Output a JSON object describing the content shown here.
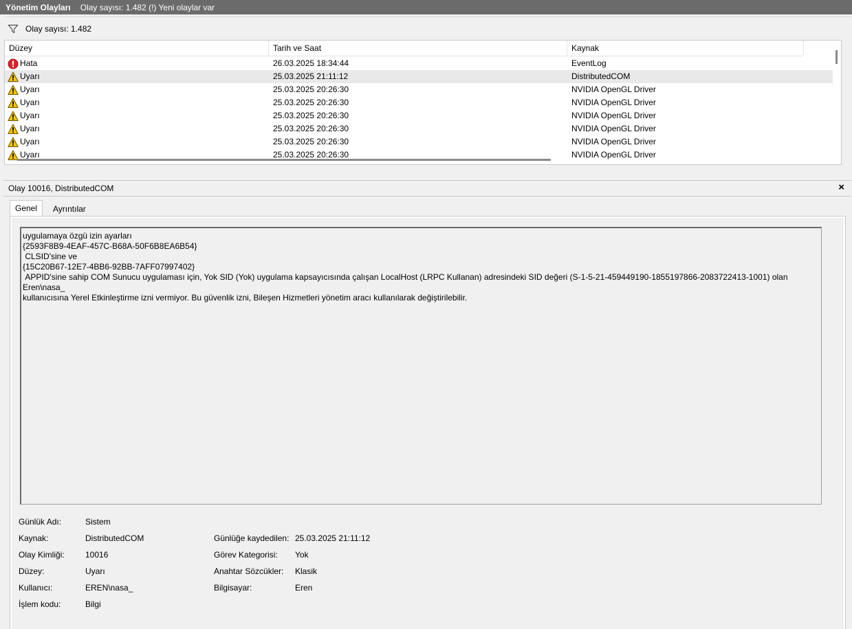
{
  "titlebar": {
    "title": "Yönetim Olayları",
    "subtitle": "Olay sayısı: 1.482 (!) Yeni olaylar var"
  },
  "filter": {
    "count_text": "Olay sayısı: 1.482",
    "icon": "filter-funnel-icon"
  },
  "columns": {
    "level": "Düzey",
    "date": "Tarih ve Saat",
    "source": "Kaynak"
  },
  "rows": [
    {
      "level": "Hata",
      "date": "26.03.2025 18:34:44",
      "source": "EventLog",
      "icon": "error-icon"
    },
    {
      "level": "Uyarı",
      "date": "25.03.2025 21:11:12",
      "source": "DistributedCOM",
      "icon": "warning-icon"
    },
    {
      "level": "Uyarı",
      "date": "25.03.2025 20:26:30",
      "source": "NVIDIA OpenGL Driver",
      "icon": "warning-icon"
    },
    {
      "level": "Uyarı",
      "date": "25.03.2025 20:26:30",
      "source": "NVIDIA OpenGL Driver",
      "icon": "warning-icon"
    },
    {
      "level": "Uyarı",
      "date": "25.03.2025 20:26:30",
      "source": "NVIDIA OpenGL Driver",
      "icon": "warning-icon"
    },
    {
      "level": "Uyarı",
      "date": "25.03.2025 20:26:30",
      "source": "NVIDIA OpenGL Driver",
      "icon": "warning-icon"
    },
    {
      "level": "Uyarı",
      "date": "25.03.2025 20:26:30",
      "source": "NVIDIA OpenGL Driver",
      "icon": "warning-icon"
    },
    {
      "level": "Uyarı",
      "date": "25.03.2025 20:26:30",
      "source": "NVIDIA OpenGL Driver",
      "icon": "warning-icon"
    }
  ],
  "colors": {
    "titlebar_bg": "#6b6b6b",
    "error": "#d9262e",
    "warning": "#f5c400",
    "selected_row": "#e9e9e9"
  },
  "detail": {
    "title": "Olay 10016, DistributedCOM",
    "close": "×",
    "tabs": {
      "general": "Genel",
      "details": "Ayrıntılar"
    },
    "message_lines": [
      "uygulamaya özgü izin ayarları",
      "{2593F8B9-4EAF-457C-B68A-50F6B8EA6B54}",
      " CLSID'sine ve",
      "{15C20B67-12E7-4BB6-92BB-7AFF07997402}",
      " APPID'sine sahip COM Sunucu uygulaması için, Yok SID (Yok) uygulama kapsayıcısında çalışan LocalHost (LRPC Kullanan) adresindeki SID değeri (S-1-5-21-459449190-1855197866-2083722413-1001) olan Eren\\nasa_",
      "kullanıcısına Yerel Etkinleştirme izni vermiyor. Bu güvenlik izni, Bileşen Hizmetleri yönetim aracı kullanılarak değiştirilebilir."
    ],
    "props": {
      "log_name_label": "Günlük Adı:",
      "log_name": "Sistem",
      "source_label": "Kaynak:",
      "source": "DistributedCOM",
      "logged_label": "Günlüğe kaydedilen:",
      "logged": "25.03.2025 21:11:12",
      "event_id_label": "Olay Kimliği:",
      "event_id": "10016",
      "task_label": "Görev Kategorisi:",
      "task": "Yok",
      "level_label": "Düzey:",
      "level": "Uyarı",
      "keywords_label": "Anahtar Sözcükler:",
      "keywords": "Klasik",
      "user_label": "Kullanıcı:",
      "user": "EREN\\nasa_",
      "computer_label": "Bilgisayar:",
      "computer": "Eren",
      "opcode_label": "İşlem kodu:",
      "opcode": "Bilgi"
    }
  }
}
